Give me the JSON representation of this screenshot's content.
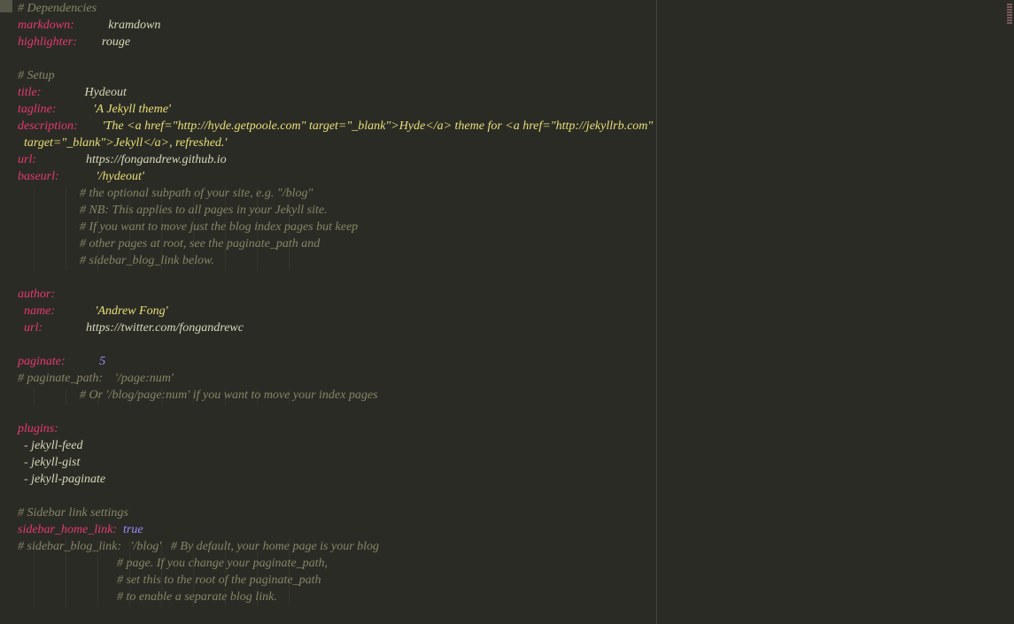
{
  "lines": [
    {
      "t": "comment",
      "key": "",
      "val": "# Dependencies"
    },
    {
      "t": "kv",
      "key": "markdown:",
      "val": "kramdown",
      "vc": "plain"
    },
    {
      "t": "kv",
      "key": "highlighter:",
      "val": "rouge",
      "vc": "plain"
    },
    {
      "t": "blank"
    },
    {
      "t": "comment",
      "key": "",
      "val": "# Setup"
    },
    {
      "t": "kv",
      "key": "title:",
      "val": "Hydeout",
      "vc": "plain"
    },
    {
      "t": "kv",
      "key": "tagline:",
      "val": "'A Jekyll theme'",
      "vc": "str"
    },
    {
      "t": "kv",
      "key": "description:",
      "val": "'The <a href=\"http://hyde.getpoole.com\" target=\"_blank\">Hyde</a> theme for <a href=\"http://jekyllrb.com\"",
      "vc": "str"
    },
    {
      "t": "cont",
      "pad": "  ",
      "val": "target=\"_blank\">Jekyll</a>, refreshed.'",
      "vc": "str"
    },
    {
      "t": "kv",
      "key": "url:",
      "val": "https://fongandrew.github.io",
      "vc": "plain"
    },
    {
      "t": "kv",
      "key": "baseurl:",
      "val": "'/hydeout'",
      "vc": "str"
    },
    {
      "t": "pcomment",
      "pad": "                    ",
      "val": "# the optional subpath of your site, e.g. \"/blog\""
    },
    {
      "t": "pcomment",
      "pad": "                    ",
      "val": "# NB: This applies to all pages in your Jekyll site."
    },
    {
      "t": "pcomment",
      "pad": "                    ",
      "val": "# If you want to move just the blog index pages but keep"
    },
    {
      "t": "pcomment",
      "pad": "                    ",
      "val": "# other pages at root, see the paginate_path and"
    },
    {
      "t": "pcomment",
      "pad": "                    ",
      "val": "# sidebar_blog_link below."
    },
    {
      "t": "blank"
    },
    {
      "t": "kv",
      "key": "author:",
      "val": "",
      "vc": "plain"
    },
    {
      "t": "kvpad",
      "pad": "  ",
      "key": "name:",
      "padv": "             ",
      "val": "'Andrew Fong'",
      "vc": "str"
    },
    {
      "t": "kvpad",
      "pad": "  ",
      "key": "url:",
      "padv": "              ",
      "val": "https://twitter.com/fongandrewc",
      "vc": "plain"
    },
    {
      "t": "blank"
    },
    {
      "t": "kv",
      "key": "paginate:",
      "val": "5",
      "vc": "num"
    },
    {
      "t": "comment",
      "key": "",
      "val": "# paginate_path:    '/page:num'"
    },
    {
      "t": "pcomment",
      "pad": "                    ",
      "val": "# Or '/blog/page:num' if you want to move your index pages"
    },
    {
      "t": "blank"
    },
    {
      "t": "kv",
      "key": "plugins:",
      "val": "",
      "vc": "plain"
    },
    {
      "t": "li",
      "pad": "  ",
      "val": "jekyll-feed"
    },
    {
      "t": "li",
      "pad": "  ",
      "val": "jekyll-gist"
    },
    {
      "t": "li",
      "pad": "  ",
      "val": "jekyll-paginate"
    },
    {
      "t": "blank"
    },
    {
      "t": "comment",
      "key": "",
      "val": "# Sidebar link settings"
    },
    {
      "t": "kv",
      "key": "sidebar_home_link:",
      "padv": "  ",
      "val": "true",
      "vc": "bool",
      "nopad": true
    },
    {
      "t": "commenttrail",
      "key": "",
      "val": "# sidebar_blog_link:   '/blog'",
      "trail": "   # By default, your home page is your blog"
    },
    {
      "t": "pcomment",
      "pad": "                                ",
      "val": "# page. If you change your paginate_path,"
    },
    {
      "t": "pcomment",
      "pad": "                                ",
      "val": "# set this to the root of the paginate_path"
    },
    {
      "t": "pcomment",
      "pad": "                                ",
      "val": "# to enable a separate blog link."
    }
  ],
  "keypad": 20
}
